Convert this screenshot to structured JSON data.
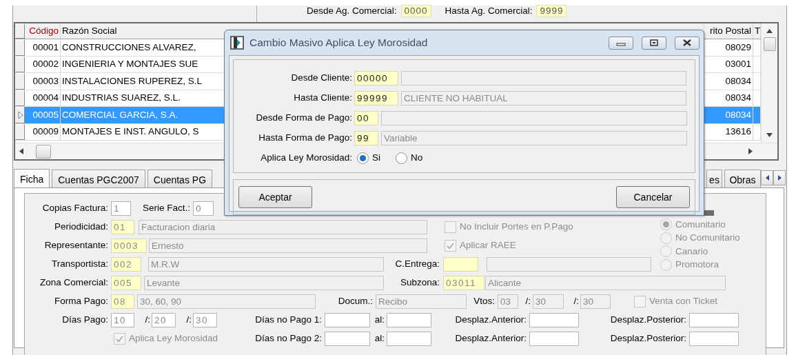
{
  "filter": {
    "from_label": "Desde Ag. Comercial:",
    "from_value": "0000",
    "to_label": "Hasta Ag. Comercial:",
    "to_value": "9999"
  },
  "grid": {
    "columns": [
      {
        "label": "Código",
        "sorted": true
      },
      {
        "label": "Razón Social",
        "sorted": false
      },
      {
        "label": "rito Postal",
        "sorted": false
      },
      {
        "label": "T",
        "sorted": false
      }
    ],
    "rows": [
      {
        "code": "00001",
        "name": "CONSTRUCCIONES ALVAREZ,",
        "postal": "08029",
        "selected": false
      },
      {
        "code": "00002",
        "name": "INGENIERIA Y MONTAJES SUE",
        "postal": "03001",
        "selected": false
      },
      {
        "code": "00003",
        "name": "INSTALACIONES RUPEREZ, S.L",
        "postal": "08034",
        "selected": false
      },
      {
        "code": "00004",
        "name": "INDUSTRIAS SUAREZ, S.L.",
        "postal": "08034",
        "selected": false
      },
      {
        "code": "00005",
        "name": "COMERCIAL GARCIA, S.A.",
        "postal": "08034",
        "selected": true
      },
      {
        "code": "00009",
        "name": "MONTAJES E INST. ANGULO, S",
        "postal": "13616",
        "selected": false
      }
    ]
  },
  "tabs": [
    {
      "label": "Ficha",
      "selected": true
    },
    {
      "label": "Cuentas PGC2007",
      "selected": false
    },
    {
      "label": "Cuentas PG",
      "selected": false
    },
    {
      "label": "es",
      "selected": false
    },
    {
      "label": "Obras",
      "selected": false
    }
  ],
  "form": {
    "rows": [
      {
        "items": [
          {
            "kind": "label",
            "text": "Copias Factura:"
          },
          {
            "kind": "text_field",
            "value": "1"
          },
          {
            "kind": "label",
            "text": "Serie Fact.:"
          },
          {
            "kind": "text_field",
            "value": "0"
          }
        ]
      },
      {
        "items": [
          {
            "kind": "label",
            "text": "Periodicidad:"
          },
          {
            "kind": "code_field",
            "value": "01"
          },
          {
            "kind": "readonly_field",
            "value": "Facturacion diaria"
          },
          {
            "kind": "checkbox",
            "label": "No Incluir Portes en P.Pago",
            "checked": false,
            "disabled": true
          }
        ]
      },
      {
        "items": [
          {
            "kind": "label",
            "text": "Representante:"
          },
          {
            "kind": "code_field",
            "value": "0003"
          },
          {
            "kind": "readonly_field",
            "value": "Ernesto"
          },
          {
            "kind": "checkbox",
            "label": "Aplicar RAEE",
            "checked": true,
            "disabled": true
          }
        ]
      },
      {
        "items": [
          {
            "kind": "label",
            "text": "Transportista:"
          },
          {
            "kind": "code_field",
            "value": "002"
          },
          {
            "kind": "readonly_field",
            "value": "M.R.W"
          },
          {
            "kind": "label",
            "text": "C.Entrega:"
          },
          {
            "kind": "code_field"
          },
          {
            "kind": "readonly_field"
          }
        ]
      },
      {
        "items": [
          {
            "kind": "label",
            "text": "Zona Comercial:"
          },
          {
            "kind": "code_field",
            "value": "005"
          },
          {
            "kind": "readonly_field",
            "value": "Levante"
          },
          {
            "kind": "label",
            "text": "Subzona:"
          },
          {
            "kind": "code_field",
            "value": "03011"
          },
          {
            "kind": "readonly_field",
            "value": "Alicante"
          }
        ]
      },
      {
        "items": [
          {
            "kind": "label",
            "text": "Forma Pago:"
          },
          {
            "kind": "code_field",
            "value": "08"
          },
          {
            "kind": "readonly_field",
            "value": "30, 60, 90"
          },
          {
            "kind": "label",
            "text": "Docum.:"
          },
          {
            "kind": "readonly_field",
            "value": "Recibo"
          },
          {
            "kind": "label",
            "text": "Vtos:"
          },
          {
            "kind": "readonly_field",
            "value": "03"
          },
          {
            "kind": "label",
            "text": "/:"
          },
          {
            "kind": "readonly_field",
            "value": "30"
          },
          {
            "kind": "label",
            "text": "/:"
          },
          {
            "kind": "readonly_field",
            "value": "30"
          },
          {
            "kind": "checkbox",
            "label": "Venta con Ticket",
            "checked": false,
            "disabled": true
          }
        ]
      },
      {
        "items": [
          {
            "kind": "label",
            "text": "Días Pago:"
          },
          {
            "kind": "text_field",
            "value": "10"
          },
          {
            "kind": "label",
            "text": "/:"
          },
          {
            "kind": "text_field",
            "value": "20"
          },
          {
            "kind": "label",
            "text": "/:"
          },
          {
            "kind": "text_field",
            "value": "30"
          },
          {
            "kind": "label",
            "text": "Días no Pago 1:"
          },
          {
            "kind": "text_field"
          },
          {
            "kind": "label",
            "text": "al:"
          },
          {
            "kind": "text_field"
          },
          {
            "kind": "label",
            "text": "Desplaz.Anterior:"
          },
          {
            "kind": "text_field"
          },
          {
            "kind": "label",
            "text": "Desplaz.Posterior:"
          },
          {
            "kind": "text_field"
          }
        ]
      },
      {
        "items": [
          {
            "kind": "checkbox",
            "label": "Aplica Ley Morosidad",
            "checked": true,
            "disabled": true
          },
          {
            "kind": "label",
            "text": "Días no Pago 2:"
          },
          {
            "kind": "text_field"
          },
          {
            "kind": "label",
            "text": "al:"
          },
          {
            "kind": "text_field"
          },
          {
            "kind": "label",
            "text": "Desplaz.Anterior:"
          },
          {
            "kind": "text_field"
          },
          {
            "kind": "label",
            "text": "Desplaz.Posterior:"
          },
          {
            "kind": "text_field"
          }
        ]
      }
    ],
    "market_options": [
      {
        "label": "Comunitario",
        "selected": true,
        "disabled": true
      },
      {
        "label": "No Comunitario",
        "selected": false,
        "disabled": true
      },
      {
        "label": "Canario",
        "selected": false,
        "disabled": true
      },
      {
        "label": "Promotora",
        "selected": false,
        "disabled": true
      }
    ]
  },
  "dialog": {
    "title": "Cambio Masivo Aplica Ley Morosidad",
    "rows": [
      {
        "label": "Desde Cliente:",
        "code": "00000"
      },
      {
        "label": "Hasta Cliente:",
        "code": "99999",
        "description": "CLIENTE NO HABITUAL"
      },
      {
        "label": "Desde Forma de Pago:",
        "code": "00"
      },
      {
        "label": "Hasta Forma de Pago:",
        "code": "99",
        "description": "Variable"
      }
    ],
    "option": {
      "label": "Aplica Ley Morosidad:",
      "choices": [
        {
          "label": "Si",
          "selected": true
        },
        {
          "label": "No",
          "selected": false
        }
      ]
    },
    "buttons": [
      "Aceptar",
      "Cancelar"
    ]
  }
}
